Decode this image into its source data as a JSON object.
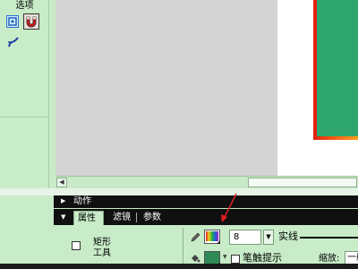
{
  "tool_panel": {
    "options_label": "选项"
  },
  "panels": {
    "actions_label": "动作",
    "tabs": [
      {
        "label": "属性",
        "active": true
      },
      {
        "label": "滤镜",
        "active": false
      },
      {
        "label": "参数",
        "active": false
      }
    ]
  },
  "properties": {
    "tool_name": "矩形\n工具",
    "stroke_width": "8",
    "stroke_style": "实线",
    "stroke_hint_label": "笔触提示",
    "scale_label": "缩放:",
    "scale_value": "一般"
  },
  "colors": {
    "fill": "#2e8a57",
    "stroke_border": "#e32010",
    "panel_bg": "#c8ecc8"
  },
  "icons": {
    "snap": "snap-to-objects-icon",
    "magnet": "magnet-icon",
    "smooth": "smooth-icon",
    "pencil": "pencil-icon",
    "bucket": "paint-bucket-icon"
  }
}
